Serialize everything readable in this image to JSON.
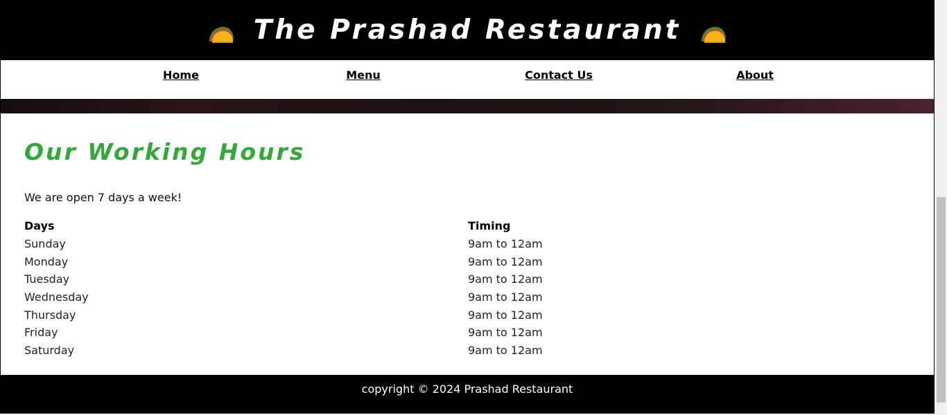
{
  "header": {
    "title": "The Prashad Restaurant",
    "icon_left": "taco-icon",
    "icon_right": "taco-icon",
    "background": "#000000"
  },
  "nav": {
    "items": [
      {
        "label": "Home"
      },
      {
        "label": "Menu"
      },
      {
        "label": "Contact Us"
      },
      {
        "label": "About"
      }
    ]
  },
  "main": {
    "heading": "Our Working Hours",
    "heading_color": "#35a83a",
    "intro": "We are open 7 days a week!",
    "table": {
      "headers": [
        "Days",
        "Timing"
      ],
      "rows": [
        [
          "Sunday",
          "9am to 12am"
        ],
        [
          "Monday",
          "9am to 12am"
        ],
        [
          "Tuesday",
          "9am to 12am"
        ],
        [
          "Wednesday",
          "9am to 12am"
        ],
        [
          "Thursday",
          "9am to 12am"
        ],
        [
          "Friday",
          "9am to 12am"
        ],
        [
          "Saturday",
          "9am to 12am"
        ]
      ]
    }
  },
  "footer": {
    "text": "copyright © 2024 Prashad Restaurant"
  }
}
